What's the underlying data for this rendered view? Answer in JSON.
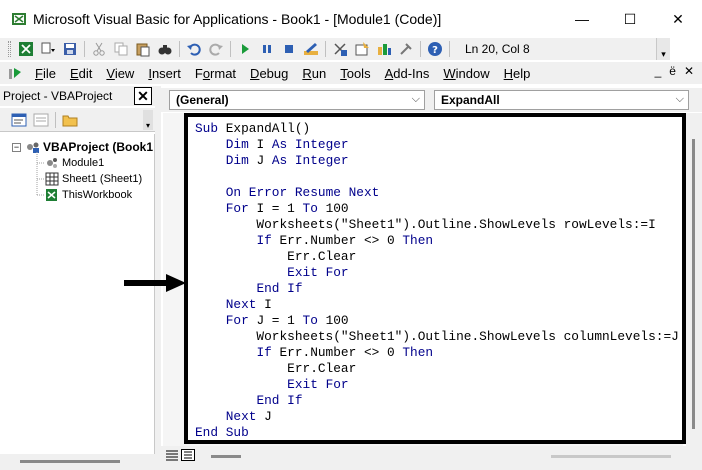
{
  "window": {
    "title": "Microsoft Visual Basic for Applications - Book1 - [Module1 (Code)]",
    "minimize": "—",
    "maximize": "☐",
    "close": "✕"
  },
  "toolbar": {
    "cursor_position": "Ln 20, Col 8",
    "icons": [
      "excel-icon",
      "insert-dropdown-icon",
      "save-icon",
      "cut-icon",
      "copy-icon",
      "paste-icon",
      "find-icon",
      "undo-icon",
      "redo-icon",
      "run-icon",
      "break-icon",
      "reset-icon",
      "design-mode-icon",
      "project-explorer-icon",
      "properties-icon",
      "object-browser-icon",
      "toolbox-icon",
      "help-icon"
    ]
  },
  "menubar": {
    "items": [
      {
        "pre": "",
        "u": "F",
        "post": "ile"
      },
      {
        "pre": "",
        "u": "E",
        "post": "dit"
      },
      {
        "pre": "",
        "u": "V",
        "post": "iew"
      },
      {
        "pre": "",
        "u": "I",
        "post": "nsert"
      },
      {
        "pre": "F",
        "u": "o",
        "post": "rmat"
      },
      {
        "pre": "",
        "u": "D",
        "post": "ebug"
      },
      {
        "pre": "",
        "u": "R",
        "post": "un"
      },
      {
        "pre": "",
        "u": "T",
        "post": "ools"
      },
      {
        "pre": "",
        "u": "A",
        "post": "dd-Ins"
      },
      {
        "pre": "",
        "u": "W",
        "post": "indow"
      },
      {
        "pre": "",
        "u": "H",
        "post": "elp"
      }
    ],
    "doc_minimize": "_",
    "doc_restore": "ё",
    "doc_close": "✕"
  },
  "project": {
    "title": "Project - VBAProject",
    "close": "✕",
    "root": "VBAProject (Book1",
    "items": [
      "Module1",
      "Sheet1 (Sheet1)",
      "ThisWorkbook"
    ]
  },
  "code": {
    "object_combo": "(General)",
    "procedure_combo": "ExpandAll",
    "lines": [
      "Sub ExpandAll()",
      "    Dim I As Integer",
      "    Dim J As Integer",
      "",
      "    On Error Resume Next",
      "    For I = 1 To 100",
      "        Worksheets(\"Sheet1\").Outline.ShowLevels rowLevels:=I",
      "        If Err.Number <> 0 Then",
      "            Err.Clear",
      "            Exit For",
      "        End If",
      "    Next I",
      "    For J = 1 To 100",
      "        Worksheets(\"Sheet1\").Outline.ShowLevels columnLevels:=J",
      "        If Err.Number <> 0 Then",
      "            Err.Clear",
      "            Exit For",
      "        End If",
      "    Next J",
      "End Sub"
    ]
  }
}
